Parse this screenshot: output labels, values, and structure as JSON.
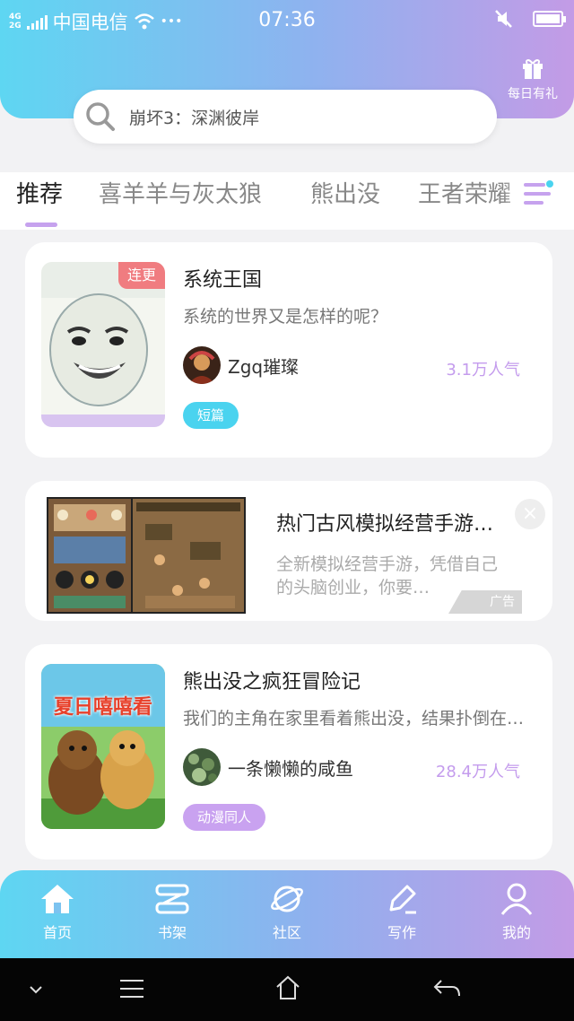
{
  "status_bar": {
    "network": [
      "4G",
      "2G"
    ],
    "carrier": "中国电信",
    "dots": "•••",
    "time": "07:36"
  },
  "header": {
    "gift_label": "每日有礼",
    "search_placeholder": "崩坏3：深渊彼岸"
  },
  "tabs": [
    {
      "label": "推荐",
      "active": true
    },
    {
      "label": "喜羊羊与灰太狼",
      "active": false
    },
    {
      "label": "熊出没",
      "active": false
    },
    {
      "label": "王者荣耀",
      "active": false
    }
  ],
  "cards": [
    {
      "badge": "连更",
      "title": "系统王国",
      "desc": "系统的世界又是怎样的呢？",
      "author": "Zgq璀璨",
      "popularity": "3.1万人气",
      "tag": "短篇",
      "tag_color": "#4ad3ef"
    },
    {
      "title": "熊出没之疯狂冒险记",
      "desc": "我们的主角在家里看着熊出没，结果扑倒在电视上…",
      "author": "一条懒懒的咸鱼",
      "popularity": "28.4万人气",
      "tag": "动漫同人",
      "tag_color": "#c9a2f0",
      "cover_text": "夏日嘻嘻看"
    }
  ],
  "ad": {
    "title": "热门古风模拟经营手游…",
    "desc": "全新模拟经营手游，凭借自己的头脑创业，你要…",
    "close": "×",
    "label": "广告"
  },
  "bottom_nav": [
    {
      "label": "首页",
      "icon": "home-icon"
    },
    {
      "label": "书架",
      "icon": "bookshelf-icon"
    },
    {
      "label": "社区",
      "icon": "planet-icon"
    },
    {
      "label": "写作",
      "icon": "pen-icon"
    },
    {
      "label": "我的",
      "icon": "user-icon"
    }
  ],
  "colors": {
    "accent_purple": "#c49ced",
    "accent_cyan": "#4ad3ef",
    "badge_red": "#f07c80"
  }
}
